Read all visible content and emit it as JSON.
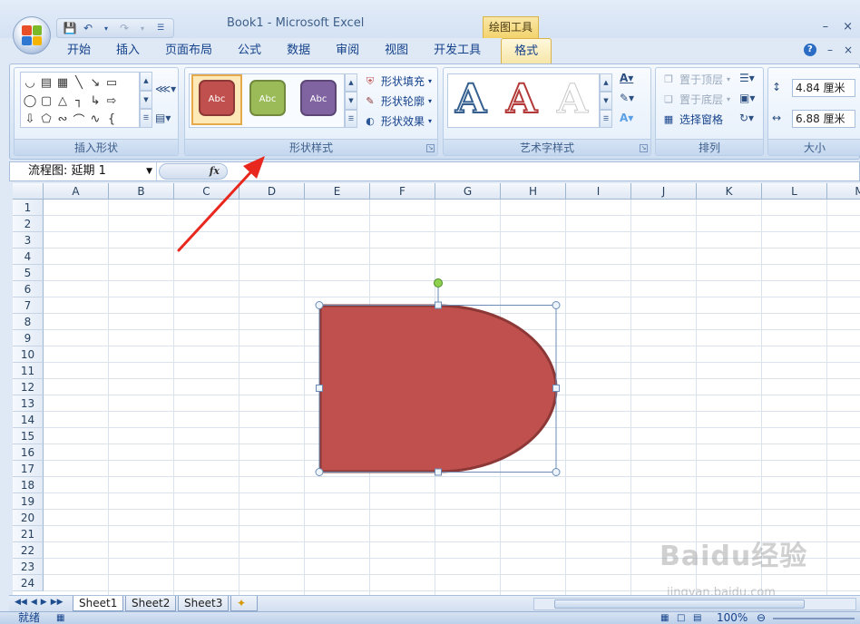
{
  "window": {
    "title": "Book1 - Microsoft Excel",
    "context_tab_group": "绘图工具",
    "minimize": "–",
    "close": "×"
  },
  "tabs": [
    "开始",
    "插入",
    "页面布局",
    "公式",
    "数据",
    "审阅",
    "视图",
    "开发工具",
    "格式"
  ],
  "active_tab": "格式",
  "ribbon": {
    "groups": {
      "insert_shapes": "插入形状",
      "shape_styles": "形状样式",
      "wordart_styles": "艺术字样式",
      "arrange": "排列",
      "size": "大小"
    },
    "style_swatches": [
      {
        "label": "Abc",
        "fill": "#c0504d",
        "border": "#8c3836"
      },
      {
        "label": "Abc",
        "fill": "#9bbb59",
        "border": "#71893f"
      },
      {
        "label": "Abc",
        "fill": "#8064a2",
        "border": "#5c4776"
      }
    ],
    "shape_fill": "形状填充",
    "shape_outline": "形状轮廓",
    "shape_effects": "形状效果",
    "bring_to_front": "置于顶层",
    "send_to_back": "置于底层",
    "selection_pane": "选择窗格",
    "height": "4.84 厘米",
    "width": "6.88 厘米"
  },
  "formula_bar": {
    "name_box": "流程图: 延期 1",
    "fx": "fx"
  },
  "grid": {
    "columns": [
      "A",
      "B",
      "C",
      "D",
      "E",
      "F",
      "G",
      "H",
      "I",
      "J",
      "K",
      "L",
      "M"
    ],
    "rows": [
      "1",
      "2",
      "3",
      "4",
      "5",
      "6",
      "7",
      "8",
      "9",
      "10",
      "11",
      "12",
      "13",
      "14",
      "15",
      "16",
      "17",
      "18",
      "19",
      "20",
      "21",
      "22",
      "23",
      "24"
    ]
  },
  "shape": {
    "name": "流程图: 延期 1",
    "fill": "#c0504d",
    "outline": "#8c3836"
  },
  "sheets": [
    "Sheet1",
    "Sheet2",
    "Sheet3"
  ],
  "active_sheet": "Sheet1",
  "status": {
    "mode": "就绪",
    "zoom": "100%"
  },
  "watermark": "Baidu经验",
  "watermark_sub": "jingyan.baidu.com"
}
